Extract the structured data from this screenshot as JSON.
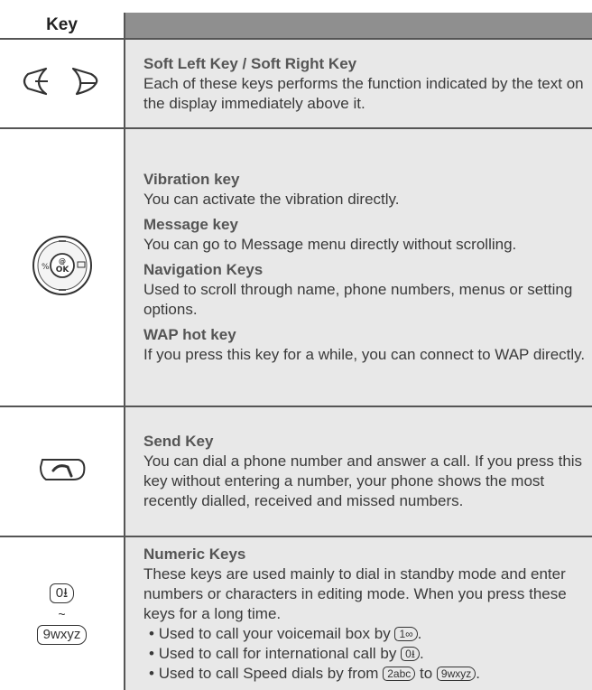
{
  "header": {
    "key_col": "Key",
    "desc_col": ""
  },
  "rows": [
    {
      "title": "Soft Left Key / Soft Right Key",
      "text": "Each of these keys performs the function indicated by the text on the display immediately above it."
    },
    {
      "blocks": [
        {
          "title": "Vibration key",
          "text": "You can activate the vibration directly."
        },
        {
          "title": "Message key",
          "text": "You can go to Message menu directly without scrolling."
        },
        {
          "title": "Navigation Keys",
          "text": "Used to scroll through name, phone numbers, menus or setting options."
        },
        {
          "title": "WAP hot key",
          "text": "If you press this key for a while, you can connect to WAP directly."
        }
      ]
    },
    {
      "title": "Send Key",
      "text": "You can dial a phone number and answer a call. If you press this key without entering a number, your phone shows the most recently dialled, received and missed numbers."
    },
    {
      "title": "Numeric Keys",
      "text": "These keys are used mainly to dial in standby mode and enter numbers or characters in editing mode. When you press these keys for a long time.",
      "bullets": {
        "voicemail_prefix": "Used to call your voicemail box by",
        "voicemail_key": "1∞",
        "intl_prefix": "Used to call for international call by",
        "intl_key": "0⭳",
        "speed_prefix": "Used to call Speed dials by from",
        "speed_from_key": "2abc",
        "speed_to_word": "to",
        "speed_to_key": "9wxyz",
        "end": "."
      },
      "key_icons": {
        "top": "0⭳",
        "sep": "~",
        "bottom": "9wxyz"
      }
    }
  ],
  "icons": [
    "soft-left-key-icon",
    "soft-right-key-icon",
    "navigation-ok-key-icon",
    "send-key-icon"
  ]
}
